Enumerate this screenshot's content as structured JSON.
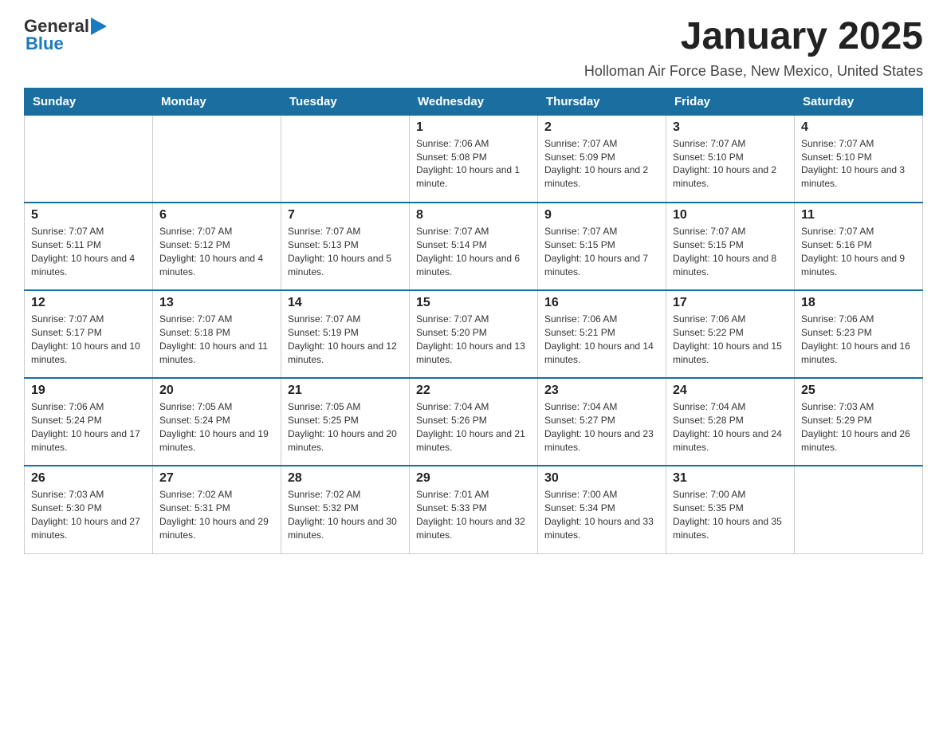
{
  "header": {
    "logo": {
      "general": "General",
      "blue": "Blue"
    },
    "title": "January 2025",
    "subtitle": "Holloman Air Force Base, New Mexico, United States"
  },
  "weekdays": [
    "Sunday",
    "Monday",
    "Tuesday",
    "Wednesday",
    "Thursday",
    "Friday",
    "Saturday"
  ],
  "weeks": [
    [
      {
        "day": "",
        "info": ""
      },
      {
        "day": "",
        "info": ""
      },
      {
        "day": "",
        "info": ""
      },
      {
        "day": "1",
        "info": "Sunrise: 7:06 AM\nSunset: 5:08 PM\nDaylight: 10 hours and 1 minute."
      },
      {
        "day": "2",
        "info": "Sunrise: 7:07 AM\nSunset: 5:09 PM\nDaylight: 10 hours and 2 minutes."
      },
      {
        "day": "3",
        "info": "Sunrise: 7:07 AM\nSunset: 5:10 PM\nDaylight: 10 hours and 2 minutes."
      },
      {
        "day": "4",
        "info": "Sunrise: 7:07 AM\nSunset: 5:10 PM\nDaylight: 10 hours and 3 minutes."
      }
    ],
    [
      {
        "day": "5",
        "info": "Sunrise: 7:07 AM\nSunset: 5:11 PM\nDaylight: 10 hours and 4 minutes."
      },
      {
        "day": "6",
        "info": "Sunrise: 7:07 AM\nSunset: 5:12 PM\nDaylight: 10 hours and 4 minutes."
      },
      {
        "day": "7",
        "info": "Sunrise: 7:07 AM\nSunset: 5:13 PM\nDaylight: 10 hours and 5 minutes."
      },
      {
        "day": "8",
        "info": "Sunrise: 7:07 AM\nSunset: 5:14 PM\nDaylight: 10 hours and 6 minutes."
      },
      {
        "day": "9",
        "info": "Sunrise: 7:07 AM\nSunset: 5:15 PM\nDaylight: 10 hours and 7 minutes."
      },
      {
        "day": "10",
        "info": "Sunrise: 7:07 AM\nSunset: 5:15 PM\nDaylight: 10 hours and 8 minutes."
      },
      {
        "day": "11",
        "info": "Sunrise: 7:07 AM\nSunset: 5:16 PM\nDaylight: 10 hours and 9 minutes."
      }
    ],
    [
      {
        "day": "12",
        "info": "Sunrise: 7:07 AM\nSunset: 5:17 PM\nDaylight: 10 hours and 10 minutes."
      },
      {
        "day": "13",
        "info": "Sunrise: 7:07 AM\nSunset: 5:18 PM\nDaylight: 10 hours and 11 minutes."
      },
      {
        "day": "14",
        "info": "Sunrise: 7:07 AM\nSunset: 5:19 PM\nDaylight: 10 hours and 12 minutes."
      },
      {
        "day": "15",
        "info": "Sunrise: 7:07 AM\nSunset: 5:20 PM\nDaylight: 10 hours and 13 minutes."
      },
      {
        "day": "16",
        "info": "Sunrise: 7:06 AM\nSunset: 5:21 PM\nDaylight: 10 hours and 14 minutes."
      },
      {
        "day": "17",
        "info": "Sunrise: 7:06 AM\nSunset: 5:22 PM\nDaylight: 10 hours and 15 minutes."
      },
      {
        "day": "18",
        "info": "Sunrise: 7:06 AM\nSunset: 5:23 PM\nDaylight: 10 hours and 16 minutes."
      }
    ],
    [
      {
        "day": "19",
        "info": "Sunrise: 7:06 AM\nSunset: 5:24 PM\nDaylight: 10 hours and 17 minutes."
      },
      {
        "day": "20",
        "info": "Sunrise: 7:05 AM\nSunset: 5:24 PM\nDaylight: 10 hours and 19 minutes."
      },
      {
        "day": "21",
        "info": "Sunrise: 7:05 AM\nSunset: 5:25 PM\nDaylight: 10 hours and 20 minutes."
      },
      {
        "day": "22",
        "info": "Sunrise: 7:04 AM\nSunset: 5:26 PM\nDaylight: 10 hours and 21 minutes."
      },
      {
        "day": "23",
        "info": "Sunrise: 7:04 AM\nSunset: 5:27 PM\nDaylight: 10 hours and 23 minutes."
      },
      {
        "day": "24",
        "info": "Sunrise: 7:04 AM\nSunset: 5:28 PM\nDaylight: 10 hours and 24 minutes."
      },
      {
        "day": "25",
        "info": "Sunrise: 7:03 AM\nSunset: 5:29 PM\nDaylight: 10 hours and 26 minutes."
      }
    ],
    [
      {
        "day": "26",
        "info": "Sunrise: 7:03 AM\nSunset: 5:30 PM\nDaylight: 10 hours and 27 minutes."
      },
      {
        "day": "27",
        "info": "Sunrise: 7:02 AM\nSunset: 5:31 PM\nDaylight: 10 hours and 29 minutes."
      },
      {
        "day": "28",
        "info": "Sunrise: 7:02 AM\nSunset: 5:32 PM\nDaylight: 10 hours and 30 minutes."
      },
      {
        "day": "29",
        "info": "Sunrise: 7:01 AM\nSunset: 5:33 PM\nDaylight: 10 hours and 32 minutes."
      },
      {
        "day": "30",
        "info": "Sunrise: 7:00 AM\nSunset: 5:34 PM\nDaylight: 10 hours and 33 minutes."
      },
      {
        "day": "31",
        "info": "Sunrise: 7:00 AM\nSunset: 5:35 PM\nDaylight: 10 hours and 35 minutes."
      },
      {
        "day": "",
        "info": ""
      }
    ]
  ]
}
